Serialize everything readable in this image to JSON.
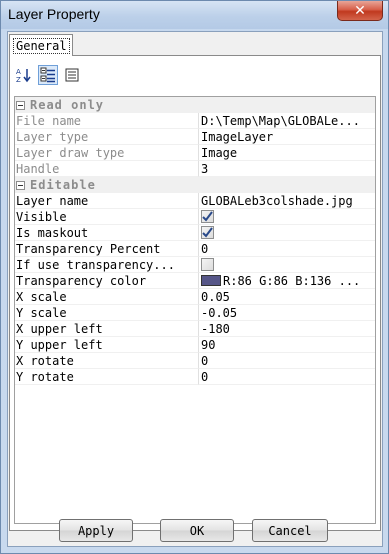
{
  "window": {
    "title": "Layer Property",
    "close_label": "✕"
  },
  "tabs": [
    {
      "label": "General"
    }
  ],
  "toolbar": {
    "sort_label": "A↓Z",
    "categorized": "categorized-icon",
    "pages": "property-pages-icon"
  },
  "categories": {
    "readonly": {
      "label": "Read only",
      "rows": [
        {
          "name": "File name",
          "value": "D:\\Temp\\Map\\GLOBALe..."
        },
        {
          "name": "Layer type",
          "value": "ImageLayer"
        },
        {
          "name": "Layer draw type",
          "value": "Image"
        },
        {
          "name": "Handle",
          "value": "3"
        }
      ]
    },
    "editable": {
      "label": "Editable",
      "rows": [
        {
          "name": "Layer name",
          "value": "GLOBALeb3colshade.jpg"
        },
        {
          "name": "Visible",
          "checked": true
        },
        {
          "name": "Is maskout",
          "checked": true
        },
        {
          "name": "Transparency Percent",
          "value": "0"
        },
        {
          "name": "If use transparency...",
          "checked": false
        },
        {
          "name": "Transparency color",
          "value": "R:86 G:86 B:136 ...",
          "color": "#565688"
        },
        {
          "name": "X scale",
          "value": "0.05"
        },
        {
          "name": "Y scale",
          "value": "-0.05"
        },
        {
          "name": "X upper left",
          "value": "-180"
        },
        {
          "name": "Y upper left",
          "value": "90"
        },
        {
          "name": "X rotate",
          "value": "0"
        },
        {
          "name": "Y rotate",
          "value": "0"
        }
      ]
    }
  },
  "buttons": {
    "apply": "Apply",
    "ok": "OK",
    "cancel": "Cancel"
  },
  "colors": {
    "accent": "#6f9fd8",
    "close": "#c0391f"
  }
}
